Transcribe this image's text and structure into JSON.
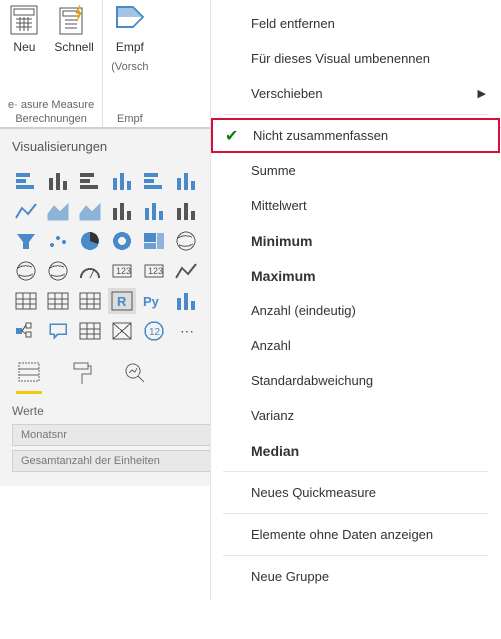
{
  "ribbon": {
    "group1": {
      "neu_label": "Neu",
      "schnell_label": "Schnell",
      "sublabel": "e· asure Measure",
      "caption": "Berechnungen"
    },
    "group2": {
      "empf_label": "Empf",
      "sub1": "(Vorsch",
      "caption": "Empf"
    }
  },
  "panel": {
    "title": "Visualisierungen",
    "section_label": "Werte",
    "field1": "Monatsnr",
    "field2": "Gesamtanzahl der Einheiten"
  },
  "viz_icons": [
    "stacked-bar",
    "clustered-bar",
    "stacked-column",
    "clustered-column",
    "stacked-bar-100",
    "column-100",
    "line",
    "area",
    "stacked-area",
    "line-column",
    "ribbon",
    "waterfall",
    "funnel",
    "scatter",
    "pie",
    "donut",
    "treemap",
    "map",
    "filled-map",
    "shape-map",
    "gauge",
    "card",
    "multi-card",
    "kpi",
    "slicer",
    "table",
    "matrix",
    "r-visual",
    "python-visual",
    "key-influencers",
    "decomposition",
    "q-and-a",
    "paginated",
    "arcgis",
    "powerapps",
    "custom"
  ],
  "menu": {
    "remove": "Feld entfernen",
    "rename": "Für dieses Visual umbenennen",
    "move": "Verschieben",
    "dontsum": "Nicht zusammenfassen",
    "sum": "Summe",
    "avg": "Mittelwert",
    "min": "Minimum",
    "max": "Maximum",
    "distinct": "Anzahl (eindeutig)",
    "count": "Anzahl",
    "stdev": "Standardabweichung",
    "var": "Varianz",
    "median": "Median",
    "quick": "Neues Quickmeasure",
    "nodata": "Elemente ohne Daten anzeigen",
    "group": "Neue Gruppe"
  },
  "colors": {
    "accent": "#f2c811",
    "blue": "#4a8ac9",
    "highlight": "#d40f3c"
  }
}
